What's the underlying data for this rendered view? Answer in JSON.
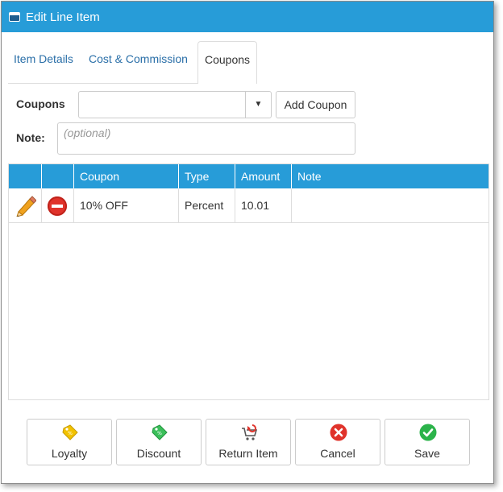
{
  "window": {
    "title": "Edit Line Item"
  },
  "tabs": [
    {
      "label": "Item Details"
    },
    {
      "label": "Cost & Commission"
    },
    {
      "label": "Coupons"
    }
  ],
  "form": {
    "coupons_label": "Coupons",
    "coupon_select_value": "",
    "add_coupon_label": "Add Coupon",
    "note_label": "Note:",
    "note_placeholder": "(optional)"
  },
  "grid": {
    "headers": [
      "",
      "",
      "Coupon",
      "Type",
      "Amount",
      "Note"
    ],
    "rows": [
      {
        "coupon": "10% OFF",
        "type": "Percent",
        "amount": "10.01",
        "note": ""
      }
    ]
  },
  "footer": {
    "buttons": [
      {
        "label": "Loyalty",
        "icon": "loyalty-tag-icon"
      },
      {
        "label": "Discount",
        "icon": "discount-tag-icon"
      },
      {
        "label": "Return Item",
        "icon": "return-cart-icon"
      },
      {
        "label": "Cancel",
        "icon": "cancel-x-icon"
      },
      {
        "label": "Save",
        "icon": "save-check-icon"
      }
    ]
  },
  "colors": {
    "header_blue": "#279cd8",
    "link_blue": "#2a6fa8",
    "delete_red": "#e0332b",
    "save_green": "#2bb34a",
    "loyalty_yellow": "#f2c200",
    "discount_green": "#3bbf5a"
  }
}
